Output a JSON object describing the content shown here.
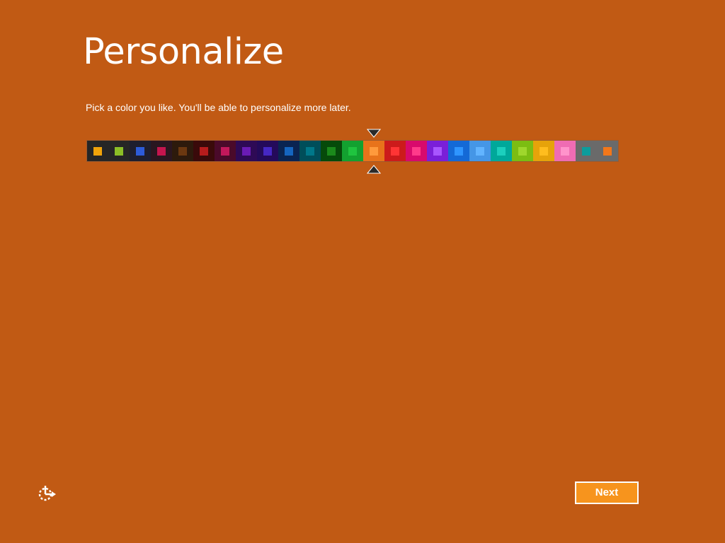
{
  "header": {
    "title": "Personalize"
  },
  "main": {
    "instruction": "Pick a color you like. You'll be able to personalize more later."
  },
  "color_picker": {
    "selected_index": 13,
    "swatches": [
      {
        "bg": "#262626",
        "chip": "#f0a30a"
      },
      {
        "bg": "#262626",
        "chip": "#8cbf26"
      },
      {
        "bg": "#1e1e2e",
        "chip": "#2d5bd8"
      },
      {
        "bg": "#2a1620",
        "chip": "#c4154e"
      },
      {
        "bg": "#2d1a0c",
        "chip": "#6b3810"
      },
      {
        "bg": "#3a0a0a",
        "chip": "#b71c1c"
      },
      {
        "bg": "#4a0a2a",
        "chip": "#c2185b"
      },
      {
        "bg": "#2e0a55",
        "chip": "#6a1bb5"
      },
      {
        "bg": "#240a5a",
        "chip": "#4527c4"
      },
      {
        "bg": "#0a2452",
        "chip": "#1565c0"
      },
      {
        "bg": "#004e5a",
        "chip": "#00788a"
      },
      {
        "bg": "#064a0a",
        "chip": "#1b8a1b"
      },
      {
        "bg": "#13a130",
        "chip": "#1fc43f"
      },
      {
        "bg": "#e8731b",
        "chip": "#ff9a3c"
      },
      {
        "bg": "#cc1b1b",
        "chip": "#ff3535"
      },
      {
        "bg": "#d80a6c",
        "chip": "#ff3a8a"
      },
      {
        "bg": "#7a1fd8",
        "chip": "#a855ff"
      },
      {
        "bg": "#1469d6",
        "chip": "#2f95ff"
      },
      {
        "bg": "#4596e6",
        "chip": "#62b4ff"
      },
      {
        "bg": "#00a89a",
        "chip": "#1ccfbd"
      },
      {
        "bg": "#7cbd12",
        "chip": "#9fd72c"
      },
      {
        "bg": "#e6a30a",
        "chip": "#ffbd1e"
      },
      {
        "bg": "#ef6cb3",
        "chip": "#ff93cb"
      },
      {
        "bg": "#6a6a6a",
        "chip": "#0c9c9c"
      },
      {
        "bg": "#6a6a6a",
        "chip": "#f2771a"
      }
    ]
  },
  "footer": {
    "next_label": "Next",
    "ease_of_access_icon": "ease-of-access-icon"
  },
  "colors": {
    "background": "#c15a14",
    "accent": "#f7941d"
  }
}
